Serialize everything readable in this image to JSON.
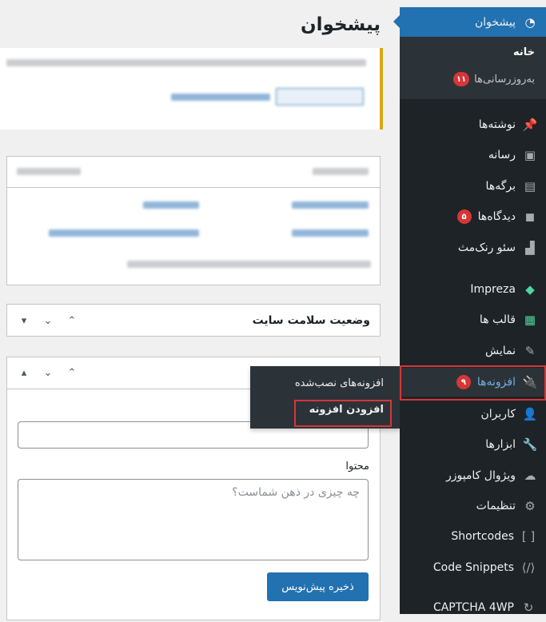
{
  "sidebar": {
    "dashboard": {
      "label": "پیشخوان",
      "icon": "gauge-icon"
    },
    "sub": {
      "home": "خانه",
      "updates": "به‌روزرسانی‌ها",
      "updates_count": "۱۱"
    },
    "items": [
      {
        "label": "نوشته‌ها",
        "icon": "pin-icon"
      },
      {
        "label": "رسانه",
        "icon": "media-icon"
      },
      {
        "label": "برگه‌ها",
        "icon": "pages-icon"
      },
      {
        "label": "دیدگاه‌ها",
        "icon": "comment-icon",
        "badge": "۵"
      },
      {
        "label": "سئو رنک‌مث",
        "icon": "chart-icon"
      },
      {
        "label": "Impreza",
        "icon": "diamond-icon"
      },
      {
        "label": "قالب ها",
        "icon": "grid-icon"
      },
      {
        "label": "نمایش",
        "icon": "brush-icon"
      },
      {
        "label": "افزونه‌ها",
        "icon": "plugin-icon",
        "badge": "۹"
      },
      {
        "label": "کاربران",
        "icon": "user-icon"
      },
      {
        "label": "ابزارها",
        "icon": "wrench-icon"
      },
      {
        "label": "ویژوال کامپوزر",
        "icon": "cloud-icon"
      },
      {
        "label": "تنظیمات",
        "icon": "settings-icon"
      },
      {
        "label": "Shortcodes",
        "icon": "brackets-icon"
      },
      {
        "label": "Code Snippets",
        "icon": "code-icon"
      },
      {
        "label": "CAPTCHA 4WP",
        "icon": "captcha-icon"
      }
    ]
  },
  "flyout": {
    "installed": "افزونه‌های نصب‌شده",
    "add_new": "افزودن افزونه"
  },
  "page": {
    "title": "پیشخوان"
  },
  "site_health": {
    "title": "وضعیت سلامت سایت"
  },
  "quick_draft": {
    "content_label": "محتوا",
    "content_placeholder": "چه چیزی در ذهن شماست؟",
    "title_value": "",
    "save_label": "ذخیره پیش‌نویس"
  },
  "colors": {
    "sidebar_bg": "#1d2327",
    "accent": "#2271b1",
    "badge": "#d63638",
    "notice_border": "#dba617",
    "highlight": "#d63638"
  }
}
